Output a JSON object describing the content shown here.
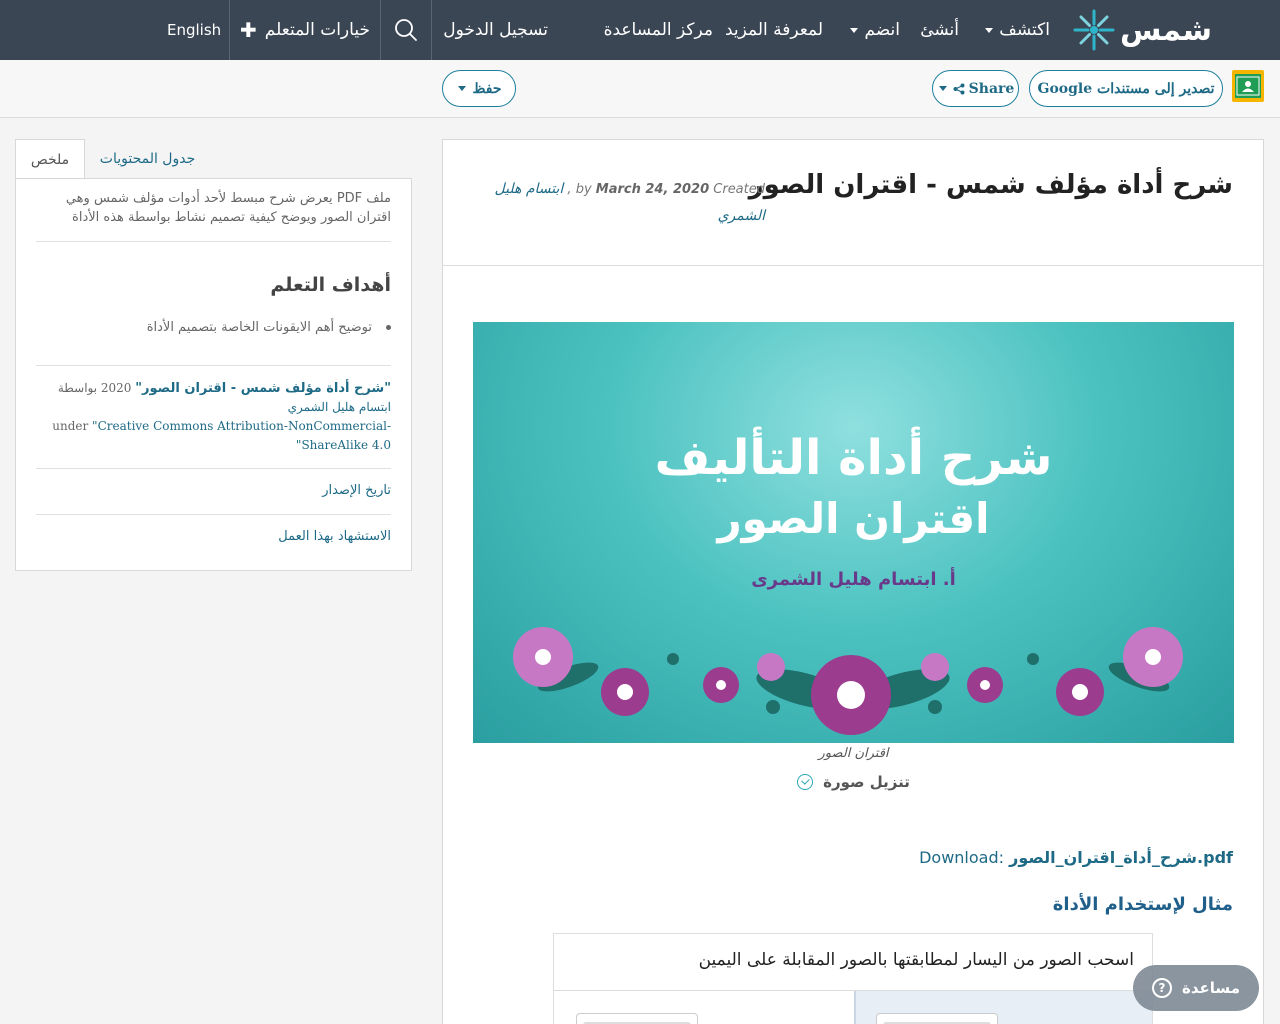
{
  "nav": {
    "logo_text": "شمس",
    "explore": "اكتشف",
    "create": "أنشئ",
    "join": "انضم",
    "learn_more": "لمعرفة المزيد",
    "help_center": "مركز المساعدة",
    "login": "تسجيل الدخول",
    "learner_options": "خيارات المتعلم",
    "language": "English"
  },
  "toolbar": {
    "export_google": "تصدير إلى مستندات Google",
    "share": "Share",
    "save": "حفظ"
  },
  "resource": {
    "title": "شرح أداة مؤلف شمس - اقتران الصور",
    "by_label": "by",
    "author": "ابتسام هليل الشمري",
    "created_label": "Created",
    "created_date": "March 24, 2020",
    "banner_line1": "شرح أداة التأليف",
    "banner_line2": "اقتران الصور",
    "banner_author": "أ. ابتسام هليل الشمرى",
    "caption": "اقتران الصور",
    "download_image": "تنزيل صورة",
    "download_label": "Download:",
    "download_file": "شرح_أداة_اقتران_الصور.pdf",
    "example_heading": "مثال لإستخدام الأداة",
    "example_instruction": "اسحب الصور من اليسار لمطابقتها بالصور المقابلة على اليمين"
  },
  "sidebar": {
    "tab_summary": "ملخص",
    "tab_toc": "جدول المحتويات",
    "summary": "ملف PDF يعرض شرح مبسط لأحد أدوات مؤلف شمس وهي اقتران الصور ويوضح كيفية تصميم نشاط بواسطة هذه الأداة",
    "goals_heading": "أهداف التعلم",
    "goals": [
      "توضيح أهم الايقونات الخاصة بتصميم الأداة"
    ],
    "attrib_title": "\"شرح أداة مؤلف شمس - اقتران الصور\"",
    "attrib_year": "2020 بواسطة",
    "attrib_author": "ابتسام هليل الشمري",
    "attrib_under": "under",
    "attrib_license": "\"Creative Commons Attribution-NonCommercial-ShareAlike 4.0\"",
    "release_history": "تاريخ الإصدار",
    "cite": "الاستشهاد بهذا العمل"
  },
  "help": {
    "label": "مساعدة"
  }
}
